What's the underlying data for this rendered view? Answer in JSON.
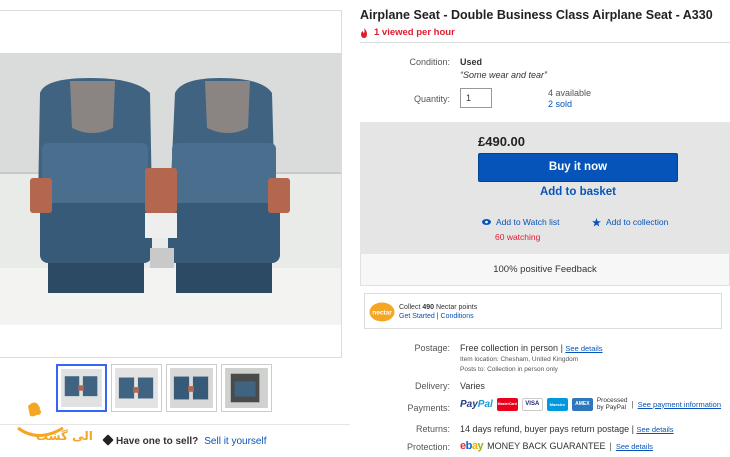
{
  "listing": {
    "title": "Airplane Seat - Double Business Class Airplane Seat - A330",
    "viewed": "1 viewed per hour",
    "condition_label": "Condition:",
    "condition": "Used",
    "condition_note": "“Some wear and tear”",
    "quantity_label": "Quantity:",
    "quantity_value": "1",
    "available": "4 available",
    "sold": "2 sold"
  },
  "buy": {
    "price": "£490.00",
    "buy_now": "Buy it now",
    "add_basket": "Add to basket",
    "watch_list": "Add to Watch list",
    "watching": "60 watching",
    "add_collection": "Add to collection",
    "feedback": "100% positive Feedback"
  },
  "nectar": {
    "logo_text": "nectar",
    "collect_prefix": "Collect ",
    "points": "490",
    "collect_suffix": " Nectar points",
    "get_started": "Get Started",
    "conditions": "Conditions"
  },
  "shipping": {
    "postage_label": "Postage:",
    "postage": "Free collection in person",
    "see_details": "See details",
    "item_location": "Item location:  Chesham, United Kingdom",
    "posts_to": "Posts to:  Collection in person only",
    "delivery_label": "Delivery:",
    "delivery": "Varies",
    "payments_label": "Payments:",
    "paypal_a": "Pay",
    "paypal_b": "Pal",
    "processed": "Processed",
    "by_paypal": "by PayPal",
    "see_payment": "See payment information",
    "returns_label": "Returns:",
    "returns": "14 days refund, buyer pays return postage",
    "protection_label": "Protection:",
    "ebay_e": "e",
    "ebay_b": "b",
    "ebay_a": "a",
    "ebay_y": "y",
    "money_back": "MONEY BACK GUARANTEE"
  },
  "cards": [
    "MasterCard",
    "VISA",
    "Maestro",
    "AMEX"
  ],
  "sell": {
    "question": "Have one to sell?",
    "link": "Sell it yourself"
  },
  "watermark": {
    "text": "الی گشت"
  },
  "colors": {
    "link": "#0654ba",
    "buy_button": "#0654ba",
    "alert_red": "#dd1e31",
    "panel_gray": "#e5e5e5"
  }
}
